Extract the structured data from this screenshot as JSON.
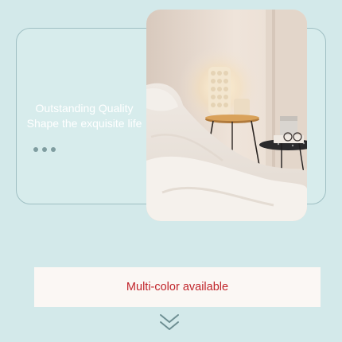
{
  "hero": {
    "tagline_line1": "Outstanding Quality",
    "tagline_line2": "Shape the exquisite life",
    "pagination_icon": "ellipsis-dots-icon",
    "photo_icon": "bedroom-lamp-photo"
  },
  "banner": {
    "text": "Multi-color available"
  },
  "scroll": {
    "icon": "double-chevron-down-icon"
  },
  "colors": {
    "background": "#d3e9ea",
    "outline": "#9fbfc3",
    "banner_text": "#c0242a",
    "banner_background": "#fbf7f4"
  }
}
